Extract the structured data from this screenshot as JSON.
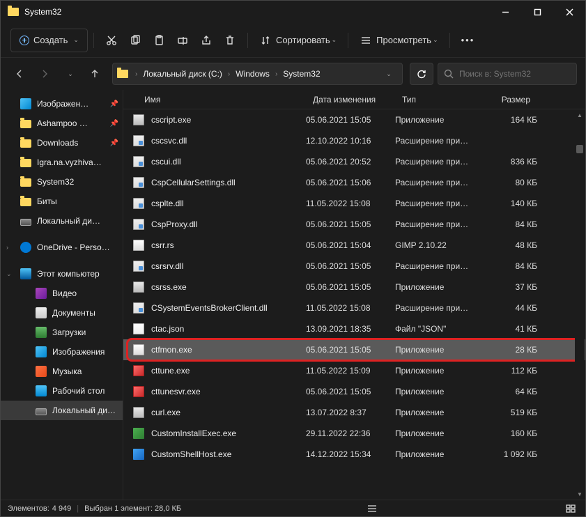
{
  "title": "System32",
  "toolbar": {
    "create": "Создать",
    "sort": "Сортировать",
    "view": "Просмотреть"
  },
  "breadcrumbs": [
    "Локальный диск (C:)",
    "Windows",
    "System32"
  ],
  "search_placeholder": "Поиск в: System32",
  "columns": {
    "name": "Имя",
    "date": "Дата изменения",
    "type": "Тип",
    "size": "Размер"
  },
  "sidebar": [
    {
      "label": "Изображен…",
      "ico": "ico-pic",
      "pin": true
    },
    {
      "label": "Ashampoo …",
      "ico": "ico-fold",
      "pin": true
    },
    {
      "label": "Downloads",
      "ico": "ico-fold",
      "pin": true
    },
    {
      "label": "Igra.na.vyzhiva…",
      "ico": "ico-fold"
    },
    {
      "label": "System32",
      "ico": "ico-fold"
    },
    {
      "label": "Биты",
      "ico": "ico-fold"
    },
    {
      "label": "Локальный ди…",
      "ico": "ico-drive"
    },
    {
      "label": "OneDrive - Perso…",
      "ico": "ico-cloud",
      "exp": "›",
      "sep": true
    },
    {
      "label": "Этот компьютер",
      "ico": "ico-pc",
      "exp": "⌄",
      "sep": true
    },
    {
      "label": "Видео",
      "ico": "ico-vid",
      "lvl": 2
    },
    {
      "label": "Документы",
      "ico": "ico-doc",
      "lvl": 2
    },
    {
      "label": "Загрузки",
      "ico": "ico-dl",
      "lvl": 2
    },
    {
      "label": "Изображения",
      "ico": "ico-pic",
      "lvl": 2
    },
    {
      "label": "Музыка",
      "ico": "ico-mus",
      "lvl": 2
    },
    {
      "label": "Рабочий стол",
      "ico": "ico-desk",
      "lvl": 2
    },
    {
      "label": "Локальный ди…",
      "ico": "ico-drive",
      "lvl": 2,
      "sel": true
    }
  ],
  "files": [
    {
      "name": "cscript.exe",
      "date": "05.06.2021 15:05",
      "type": "Приложение",
      "size": "164 КБ",
      "ico": "fi-exe"
    },
    {
      "name": "cscsvc.dll",
      "date": "12.10.2022 10:16",
      "type": "Расширение при…",
      "size": "",
      "ico": "fi-dll"
    },
    {
      "name": "cscui.dll",
      "date": "05.06.2021 20:52",
      "type": "Расширение при…",
      "size": "836 КБ",
      "ico": "fi-dll"
    },
    {
      "name": "CspCellularSettings.dll",
      "date": "05.06.2021 15:06",
      "type": "Расширение при…",
      "size": "80 КБ",
      "ico": "fi-dll"
    },
    {
      "name": "csplte.dll",
      "date": "11.05.2022 15:08",
      "type": "Расширение при…",
      "size": "140 КБ",
      "ico": "fi-dll"
    },
    {
      "name": "CspProxy.dll",
      "date": "05.06.2021 15:05",
      "type": "Расширение при…",
      "size": "84 КБ",
      "ico": "fi-dll"
    },
    {
      "name": "csrr.rs",
      "date": "05.06.2021 15:04",
      "type": "GIMP 2.10.22",
      "size": "48 КБ",
      "ico": "fi-gen"
    },
    {
      "name": "csrsrv.dll",
      "date": "05.06.2021 15:05",
      "type": "Расширение при…",
      "size": "84 КБ",
      "ico": "fi-dll"
    },
    {
      "name": "csrss.exe",
      "date": "05.06.2021 15:05",
      "type": "Приложение",
      "size": "37 КБ",
      "ico": "fi-exe"
    },
    {
      "name": "CSystemEventsBrokerClient.dll",
      "date": "11.05.2022 15:08",
      "type": "Расширение при…",
      "size": "44 КБ",
      "ico": "fi-dll"
    },
    {
      "name": "ctac.json",
      "date": "13.09.2021 18:35",
      "type": "Файл \"JSON\"",
      "size": "41 КБ",
      "ico": "fi-json"
    },
    {
      "name": "ctfmon.exe",
      "date": "05.06.2021 15:05",
      "type": "Приложение",
      "size": "28 КБ",
      "ico": "fi-gen",
      "sel": true,
      "hl": true
    },
    {
      "name": "cttune.exe",
      "date": "11.05.2022 15:09",
      "type": "Приложение",
      "size": "112 КБ",
      "ico": "fi-toon"
    },
    {
      "name": "cttunesvr.exe",
      "date": "05.06.2021 15:05",
      "type": "Приложение",
      "size": "64 КБ",
      "ico": "fi-toon"
    },
    {
      "name": "curl.exe",
      "date": "13.07.2022 8:37",
      "type": "Приложение",
      "size": "519 КБ",
      "ico": "fi-exe"
    },
    {
      "name": "CustomInstallExec.exe",
      "date": "29.11.2022 22:36",
      "type": "Приложение",
      "size": "160 КБ",
      "ico": "fi-custom"
    },
    {
      "name": "CustomShellHost.exe",
      "date": "14.12.2022 15:34",
      "type": "Приложение",
      "size": "1 092 КБ",
      "ico": "fi-blue"
    }
  ],
  "status": {
    "count_label": "Элементов:",
    "count": "4 949",
    "sel_label": "Выбран 1 элемент: 28,0 КБ"
  }
}
